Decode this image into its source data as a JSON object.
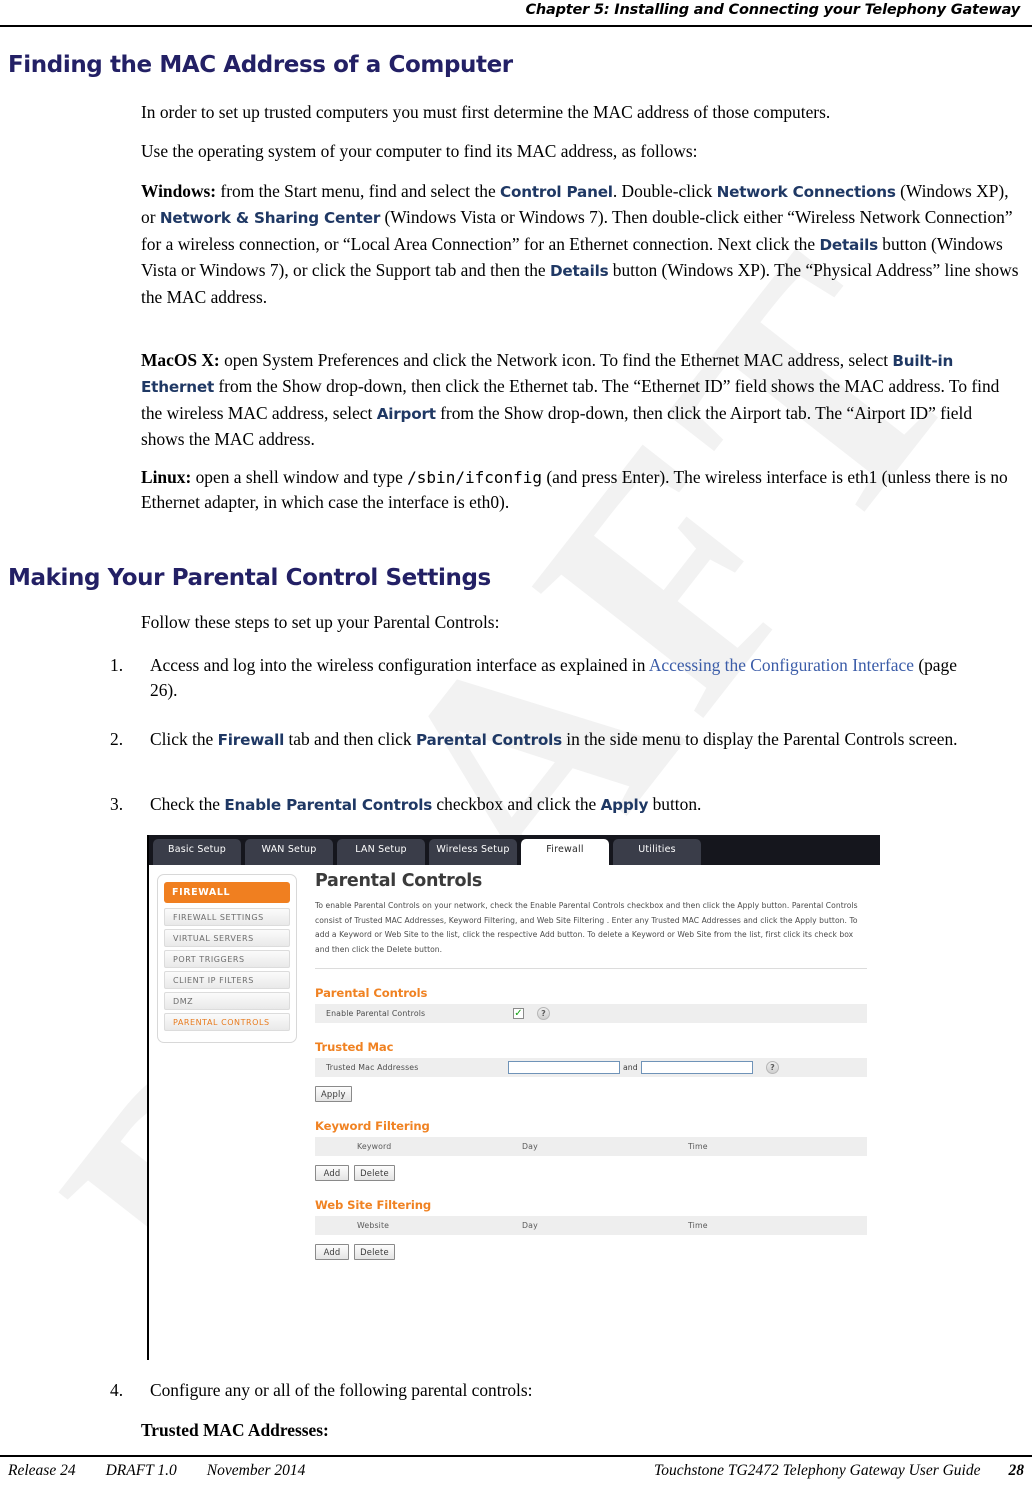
{
  "header": {
    "running_head": "Chapter 5: Installing and Connecting your Telephony Gateway"
  },
  "watermark": {
    "text": "DRAFT"
  },
  "footer": {
    "release": "Release 24",
    "draft": "DRAFT 1.0",
    "date": "November 2014",
    "guide": "Touchstone TG2472 Telephony Gateway User Guide",
    "page": "28"
  },
  "headings": {
    "mac": "Finding the MAC Address of a Computer",
    "parental": "Making Your Parental Control Settings"
  },
  "paragraphs": {
    "intro1": "In order to set up trusted computers you must first determine the MAC address of those computers.",
    "intro2": "Use the operating system of your computer to find its MAC address, as follows:",
    "windows": {
      "label": "Windows:",
      "t1": " from the Start menu, find and select the ",
      "ui1": "Control Panel",
      "t2": ". Double-click ",
      "ui2": "Network Connections",
      "t3": " (Windows XP), or ",
      "ui3": "Network & Sharing Center",
      "t4": " (Windows Vista or Windows 7). Then double-click either “Wireless Network Connection” for a wireless connection, or “Local Area Connection” for an Ethernet connection. Next click the ",
      "ui4": "Details",
      "t5": " button (Windows Vista or Windows 7), or click the Support tab and then the ",
      "ui5": "Details",
      "t6": " button (Windows XP). The “Physical Address” line shows the MAC address."
    },
    "macos": {
      "label": "MacOS X:",
      "t1": " open System Preferences and click the Network icon. To find the Ethernet MAC address, select ",
      "ui1": "Built-in Ethernet",
      "t2": " from the Show drop-down, then click the Ethernet tab. The “Ethernet ID” field shows the MAC address. To find the wireless MAC address, select ",
      "ui2": "Airport",
      "t3": " from the Show drop-down, then click the Airport tab. The “Airport ID” field shows the MAC address."
    },
    "linux": {
      "label": "Linux:",
      "t1": " open a shell window and type ",
      "code": "/sbin/ifconfig",
      "t2": " (and press Enter). The wireless interface is eth1 (unless there is no Ethernet adapter, in which case the interface is eth0)."
    },
    "follow": "Follow these steps to set up your Parental Controls:",
    "step4": "Configure any or all of the following parental controls:",
    "trusted_mac_head": "Trusted MAC Addresses:"
  },
  "steps": [
    {
      "num": "1.",
      "t1": "Access and log into the wireless configuration interface as explained in ",
      "xref": "Accessing the Configuration Interface",
      "t2": " (page 26)."
    },
    {
      "num": "2.",
      "t1": "Click the ",
      "ui1": "Firewall",
      "t2": " tab and then click ",
      "ui2": "Parental Controls",
      "t3": " in the side menu to display the Parental Controls screen."
    },
    {
      "num": "3.",
      "t1": "Check the ",
      "ui1": "Enable Parental Controls",
      "t2": " checkbox and click the ",
      "ui2": "Apply",
      "t3": " button."
    }
  ],
  "router_screenshot": {
    "tabs": [
      {
        "label": "Basic Setup",
        "active": false
      },
      {
        "label": "WAN Setup",
        "active": false
      },
      {
        "label": "LAN Setup",
        "active": false
      },
      {
        "label": "Wireless Setup",
        "active": false
      },
      {
        "label": "Firewall",
        "active": true
      },
      {
        "label": "Utilities",
        "active": false
      }
    ],
    "sidebar": {
      "header": "FIREWALL",
      "items": [
        {
          "label": "FIREWALL SETTINGS",
          "current": false
        },
        {
          "label": "VIRTUAL SERVERS",
          "current": false
        },
        {
          "label": "PORT TRIGGERS",
          "current": false
        },
        {
          "label": "CLIENT IP FILTERS",
          "current": false
        },
        {
          "label": "DMZ",
          "current": false
        },
        {
          "label": "PARENTAL CONTROLS",
          "current": true
        }
      ]
    },
    "page_title": "Parental Controls",
    "intro": "To enable Parental Controls on your network, check the Enable Parental Controls checkbox and then click the Apply button. Parental Controls consist of Trusted MAC Addresses, Keyword Filtering, and Web Site Filtering . Enter any Trusted MAC Addresses and click the Apply button. To add a Keyword or Web Site to the list, click the respective Add button. To delete a Keyword or Web Site from the list, first click its check box and then click the Delete button.",
    "groups": {
      "parental_controls": {
        "title": "Parental Controls",
        "row_label": "Enable Parental Controls",
        "checkbox_checked": true,
        "help": "?"
      },
      "trusted_mac": {
        "title": "Trusted Mac",
        "row_label": "Trusted Mac Addresses",
        "field1": "",
        "and": "and",
        "field2": "",
        "help": "?",
        "apply_label": "Apply"
      },
      "keyword_filtering": {
        "title": "Keyword Filtering",
        "columns": [
          "Keyword",
          "Day",
          "Time"
        ],
        "add_label": "Add",
        "delete_label": "Delete"
      },
      "website_filtering": {
        "title": "Web Site Filtering",
        "columns": [
          "Website",
          "Day",
          "Time"
        ],
        "add_label": "Add",
        "delete_label": "Delete"
      }
    },
    "colors": {
      "accent_orange": "#f08222",
      "tab_dark": "#3a3d49",
      "tabbar_bg": "#15161d"
    }
  },
  "colors": {
    "heading_navy": "#232065",
    "ui_term_blue": "#1f3864",
    "xref_blue": "#3b5ca8"
  }
}
